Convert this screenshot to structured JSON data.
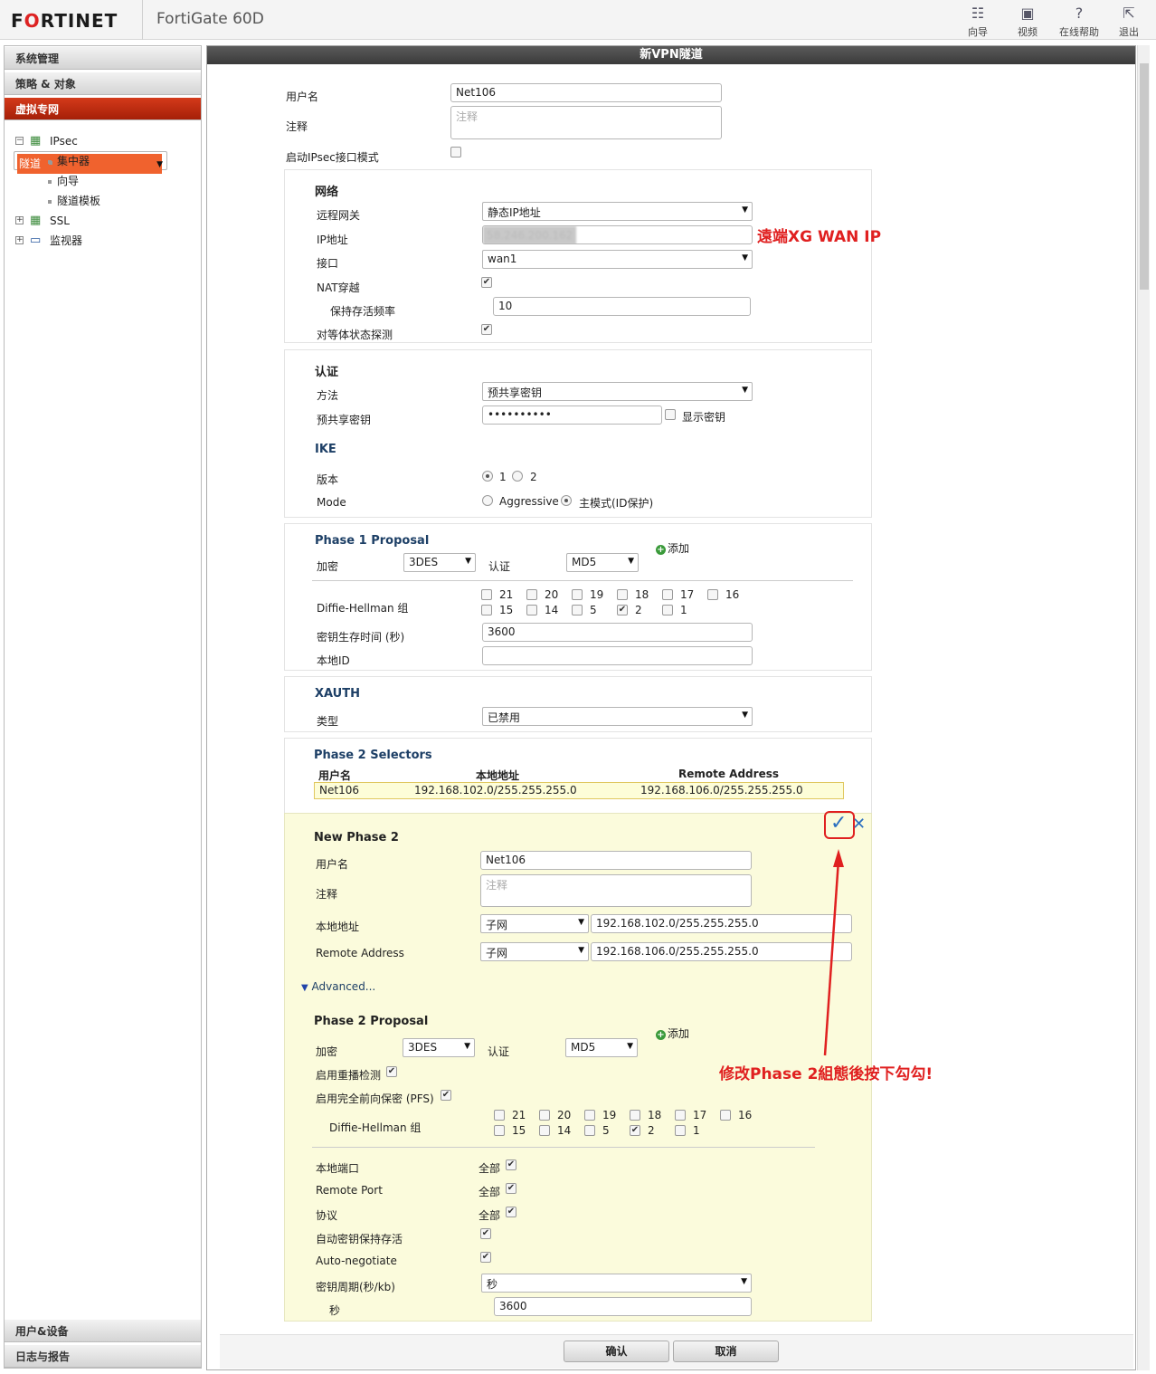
{
  "header": {
    "logo_pre": "F",
    "logo_o": "O",
    "logo_post": "RTINET",
    "product": "FortiGate 60D",
    "buttons": [
      {
        "label": "向导",
        "icon": "wizard-icon"
      },
      {
        "label": "视频",
        "icon": "video-icon"
      },
      {
        "label": "在线帮助",
        "icon": "help-icon"
      },
      {
        "label": "退出",
        "icon": "logout-icon"
      }
    ]
  },
  "sidebar": {
    "sections": [
      "系统管理",
      "策略 & 对象",
      "虚拟专网"
    ],
    "footer": [
      "用户&设备",
      "日志与报告"
    ],
    "tree": {
      "ipsec": "IPsec",
      "ipsec_children": [
        "隧道",
        "集中器",
        "向导",
        "隧道模板"
      ],
      "ssl": "SSL",
      "monitor": "监视器"
    }
  },
  "form": {
    "title": "新VPN隧道",
    "name_label": "用户名",
    "name_value": "Net106",
    "comment_label": "注释",
    "comment_placeholder": "注释",
    "ipsec_interface_label": "启动IPsec接口模式",
    "network": {
      "title": "网络",
      "gateway_label": "远程网关",
      "gateway_value": "静态IP地址",
      "ip_label": "IP地址",
      "ip_value": "58.246.200.162",
      "interface_label": "接口",
      "interface_value": "wan1",
      "nat_label": "NAT穿越",
      "keepalive_label": "保持存活频率",
      "keepalive_value": "10",
      "dpd_label": "对等体状态探测"
    },
    "auth": {
      "title": "认证",
      "method_label": "方法",
      "method_value": "预共享密钥",
      "psk_label": "预共享密钥",
      "psk_value": "••••••••••",
      "show_label": "显示密钥"
    },
    "ike": {
      "title": "IKE",
      "version_label": "版本",
      "v1": "1",
      "v2": "2",
      "mode_label": "Mode",
      "aggressive": "Aggressive",
      "main": "主模式(ID保护)"
    },
    "phase1": {
      "title": "Phase 1 Proposal",
      "add": "添加",
      "enc_label": "加密",
      "enc_value": "3DES",
      "auth_label": "认证",
      "auth_value": "MD5",
      "dh_label": "Diffie-Hellman 组",
      "dh_row1": [
        "21",
        "20",
        "19",
        "18",
        "17",
        "16"
      ],
      "dh_row2": [
        "15",
        "14",
        "5",
        "2",
        "1"
      ],
      "keylife_label": "密钥生存时间 (秒)",
      "keylife_value": "3600",
      "localid_label": "本地ID"
    },
    "xauth": {
      "title": "XAUTH",
      "type_label": "类型",
      "type_value": "已禁用"
    },
    "phase2sel": {
      "title": "Phase 2 Selectors",
      "col_name": "用户名",
      "col_local": "本地地址",
      "col_remote": "Remote Address",
      "row_name": "Net106",
      "row_local": "192.168.102.0/255.255.255.0",
      "row_remote": "192.168.106.0/255.255.255.0"
    },
    "newphase2": {
      "title": "New Phase 2",
      "name_label": "用户名",
      "name_value": "Net106",
      "comment_label": "注释",
      "comment_placeholder": "注释",
      "local_label": "本地地址",
      "local_type": "子网",
      "local_value": "192.168.102.0/255.255.255.0",
      "remote_label": "Remote Address",
      "remote_type": "子网",
      "remote_value": "192.168.106.0/255.255.255.0",
      "advanced": "Advanced...",
      "ok_glyph": "✓",
      "x_glyph": "✕"
    },
    "phase2": {
      "title": "Phase 2 Proposal",
      "add": "添加",
      "enc_label": "加密",
      "enc_value": "3DES",
      "auth_label": "认证",
      "auth_value": "MD5",
      "replay_label": "启用重播检测",
      "pfs_label": "启用完全前向保密 (PFS)",
      "dh_label": "Diffie-Hellman 组",
      "dh_row1": [
        "21",
        "20",
        "19",
        "18",
        "17",
        "16"
      ],
      "dh_row2": [
        "15",
        "14",
        "5",
        "2",
        "1"
      ],
      "localport_label": "本地端口",
      "all": "全部",
      "remoteport_label": "Remote Port",
      "protocol_label": "协议",
      "autokey_label": "自动密钥保持存活",
      "autoneg_label": "Auto-negotiate",
      "keylife_label": "密钥周期(秒/kb)",
      "keylife_type": "秒",
      "sec_label": "秒",
      "sec_value": "3600"
    },
    "ok_button": "确认",
    "cancel_button": "取消"
  },
  "annotations": {
    "wan_ip": "遠端XG WAN IP",
    "phase2_note": "修改Phase 2組態後按下勾勾!"
  },
  "colors": {
    "accent": "#d22",
    "annotation": "#e02020",
    "sidebar_active": "#b92a0e"
  }
}
